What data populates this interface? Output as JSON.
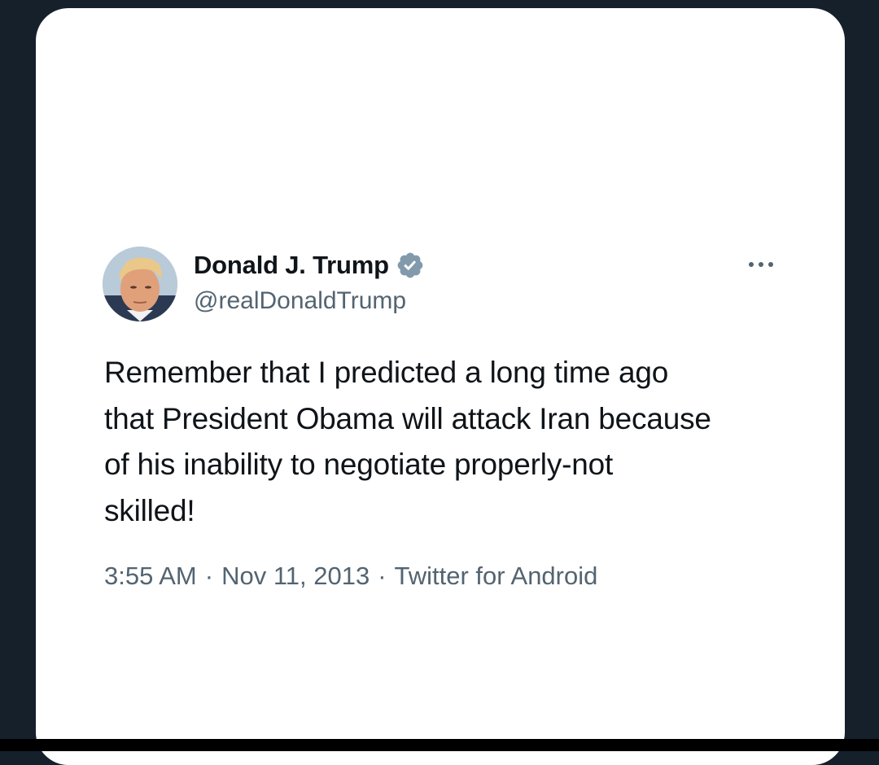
{
  "tweet": {
    "author": {
      "display_name": "Donald J. Trump",
      "handle": "@realDonaldTrump",
      "verified": true,
      "verified_color": "#829aab"
    },
    "text": "Remember that I predicted a long time ago\nthat President Obama will attack Iran because\nof his inability to negotiate properly-not\nskilled!",
    "meta": {
      "time": "3:55 AM",
      "date": "Nov 11, 2013",
      "separator": "·",
      "source": "Twitter for Android"
    }
  },
  "icons": {
    "more": "more-options-icon",
    "verified": "verified-badge-icon"
  },
  "colors": {
    "background": "#15202b",
    "card": "#ffffff",
    "text_primary": "#0f1419",
    "text_secondary": "#536471"
  }
}
